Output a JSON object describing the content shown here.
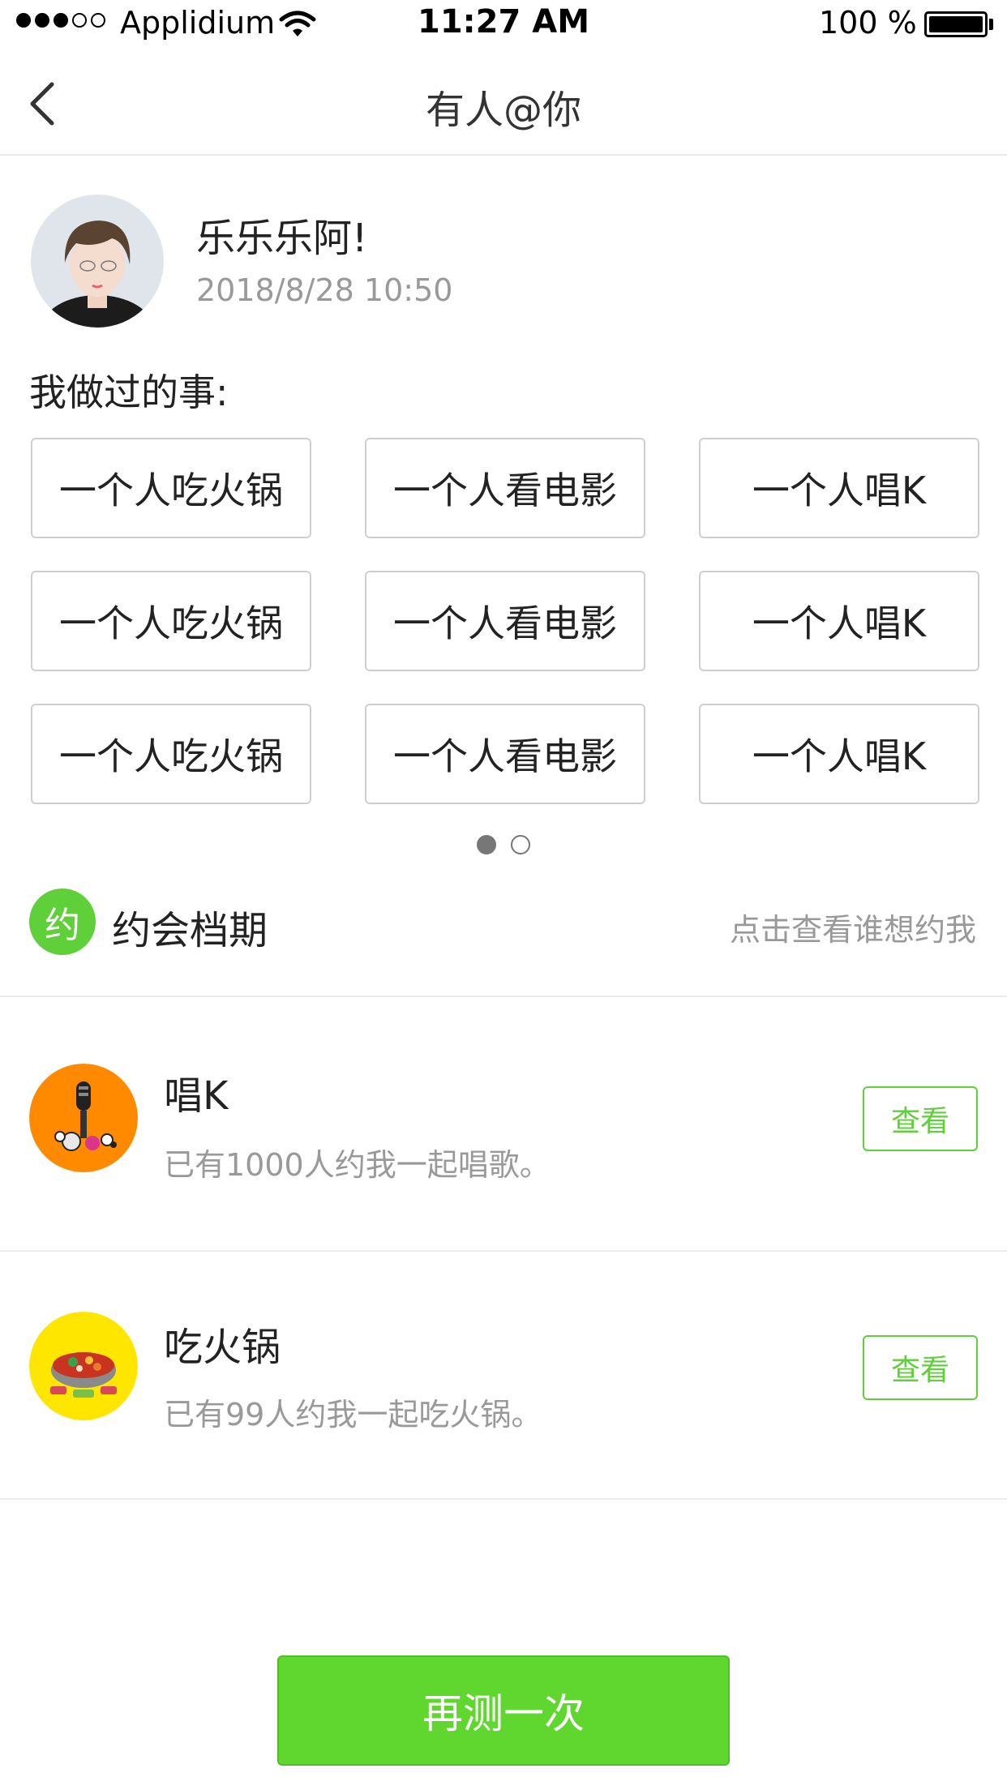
{
  "status_bar": {
    "carrier": "Applidium",
    "time": "11:27 AM",
    "battery": "100 %"
  },
  "nav": {
    "back_icon": "chevron-left-icon",
    "title": "有人@你"
  },
  "profile": {
    "name": "乐乐乐阿!",
    "time": "2018/8/28   10:50"
  },
  "things": {
    "title": "我做过的事:",
    "tags": [
      "一个人吃火锅",
      "一个人看电影",
      "一个人唱K",
      "一个人吃火锅",
      "一个人看电影",
      "一个人唱K",
      "一个人吃火锅",
      "一个人看电影",
      "一个人唱K"
    ],
    "pager": {
      "total": 2,
      "active": 1
    }
  },
  "dates": {
    "badge": "约",
    "title": "约会档期",
    "hint": "点击查看谁想约我",
    "items": [
      {
        "title": "唱K",
        "desc": "已有1000人约我一起唱歌。",
        "button": "查看",
        "icon": "microphone-icon",
        "color": "#ff8a00"
      },
      {
        "title": "吃火锅",
        "desc": "已有99人约我一起吃火锅。",
        "button": "查看",
        "icon": "hotpot-icon",
        "color": "#ffe600"
      }
    ]
  },
  "action": {
    "retest": "再测一次"
  },
  "colors": {
    "accent": "#5fcf3a",
    "button": "#5fd72f"
  }
}
